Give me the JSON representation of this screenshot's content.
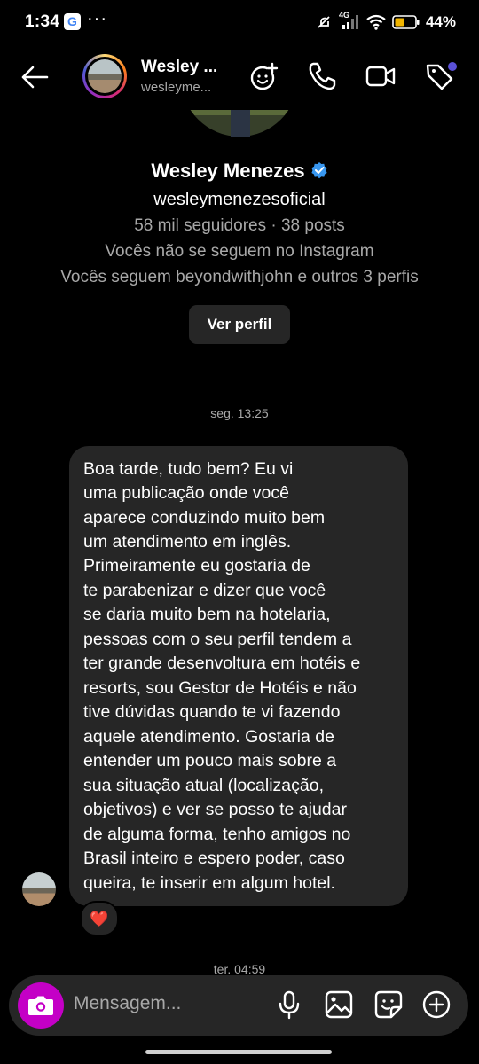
{
  "status_bar": {
    "time": "1:34",
    "google_badge": "G",
    "more_dots": "···",
    "network_label": "4G",
    "battery_percent": "44%",
    "icons": [
      "google-icon",
      "more-icon",
      "mute-icon",
      "signal-icon",
      "wifi-icon",
      "battery-icon"
    ]
  },
  "header": {
    "name": "Wesley ...",
    "username": "wesleyme...",
    "actions": [
      "add-effect-icon",
      "phone-icon",
      "video-icon",
      "tag-icon"
    ]
  },
  "profile": {
    "name": "Wesley Menezes",
    "username": "wesleymenezesoficial",
    "stats": "58 mil seguidores · 38 posts",
    "follow_status": "Vocês não se seguem no Instagram",
    "mutual": "Vocês seguem beyondwithjohn e outros 3 perfis",
    "view_profile_label": "Ver perfil"
  },
  "messages": [
    {
      "timestamp": "seg. 13:25",
      "text_lines": [
        "Boa tarde, tudo bem? Eu vi",
        "uma publicação onde você",
        "aparece conduzindo muito bem",
        "um atendimento em inglês.",
        "Primeiramente eu gostaria de",
        "te parabenizar e dizer que você",
        "se daria muito bem na hotelaria,",
        "pessoas com o seu perfil tendem a",
        "ter grande desenvoltura em hotéis e",
        "resorts, sou Gestor de Hotéis e não",
        "tive dúvidas quando te vi fazendo",
        "aquele atendimento. Gostaria de",
        "entender um pouco mais sobre a",
        "sua situação atual (localização,",
        "objetivos) e ver se posso te ajudar",
        "de alguma forma, tenho amigos no",
        "Brasil inteiro e espero poder, caso",
        "queira, te inserir em algum hotel."
      ],
      "reaction": "❤️"
    }
  ],
  "next_timestamp": "ter. 04:59",
  "composer": {
    "placeholder": "Mensagem...",
    "icons": [
      "camera-icon",
      "microphone-icon",
      "gallery-icon",
      "sticker-icon",
      "plus-icon"
    ]
  },
  "colors": {
    "background": "#000000",
    "bubble": "#262626",
    "secondary_text": "#a8a8a8",
    "camera_button": "#c400c6",
    "verified_badge": "#3897f0"
  }
}
